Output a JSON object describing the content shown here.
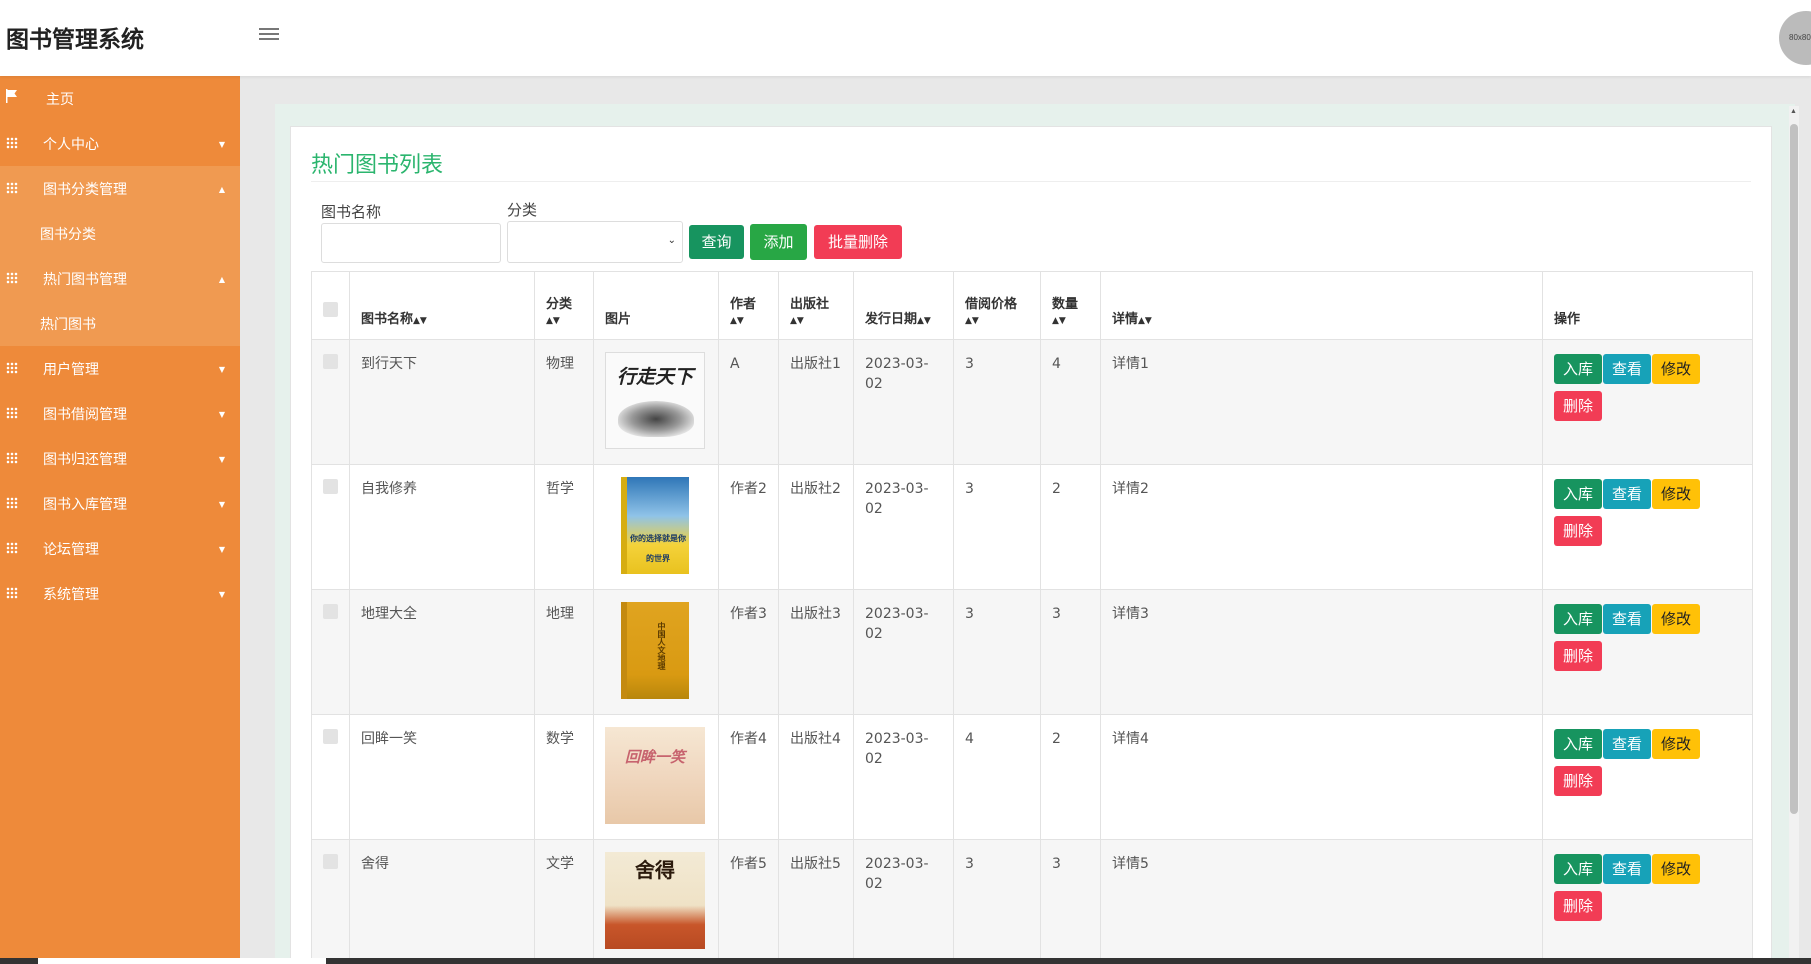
{
  "app": {
    "title": "图书管理系统",
    "avatar_text": "80x80"
  },
  "sidebar": {
    "items": [
      {
        "label": "主页"
      },
      {
        "label": "个人中心"
      },
      {
        "label": "图书分类管理",
        "sub": "图书分类"
      },
      {
        "label": "热门图书管理",
        "sub": "热门图书"
      },
      {
        "label": "用户管理"
      },
      {
        "label": "图书借阅管理"
      },
      {
        "label": "图书归还管理"
      },
      {
        "label": "图书入库管理"
      },
      {
        "label": "论坛管理"
      },
      {
        "label": "系统管理"
      }
    ]
  },
  "page": {
    "title": "热门图书列表"
  },
  "search": {
    "name_label": "图书名称",
    "category_label": "分类",
    "query_button": "查询",
    "add_button": "添加",
    "batch_delete_button": "批量删除"
  },
  "table": {
    "headers": [
      "图书名称",
      "分类",
      "图片",
      "作者",
      "出版社",
      "发行日期",
      "借阅价格",
      "数量",
      "详情",
      "操作"
    ],
    "actions": {
      "stock_in": "入库",
      "view": "查看",
      "edit": "修改",
      "delete": "删除"
    },
    "rows": [
      {
        "name": "到行天下",
        "category": "物理",
        "cover_text": "行走天下",
        "author": "A",
        "publisher": "出版社1",
        "date": "2023-03-02",
        "price": "3",
        "qty": "4",
        "detail": "详情1"
      },
      {
        "name": "自我修养",
        "category": "哲学",
        "cover_text": "你的选择就是你的世界",
        "author": "作者2",
        "publisher": "出版社2",
        "date": "2023-03-02",
        "price": "3",
        "qty": "2",
        "detail": "详情2"
      },
      {
        "name": "地理大全",
        "category": "地理",
        "cover_text": "中国人文地理",
        "author": "作者3",
        "publisher": "出版社3",
        "date": "2023-03-02",
        "price": "3",
        "qty": "3",
        "detail": "详情3"
      },
      {
        "name": "回眸一笑",
        "category": "数学",
        "cover_text": "回眸一笑",
        "author": "作者4",
        "publisher": "出版社4",
        "date": "2023-03-02",
        "price": "4",
        "qty": "2",
        "detail": "详情4"
      },
      {
        "name": "舍得",
        "category": "文学",
        "cover_text": "舍得",
        "author": "作者5",
        "publisher": "出版社5",
        "date": "2023-03-02",
        "price": "3",
        "qty": "3",
        "detail": "详情5"
      }
    ]
  },
  "colors": {
    "sidebar": "#ee8a3a",
    "accent_title": "#2bb56e",
    "query": "#17945f",
    "add": "#28a745",
    "danger": "#f23c55",
    "info": "#17a2b8",
    "warning": "#ffc107"
  }
}
